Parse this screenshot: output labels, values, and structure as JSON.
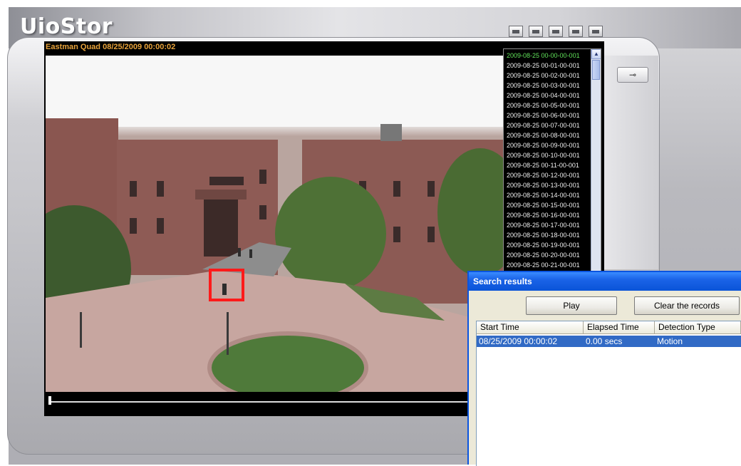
{
  "app": {
    "logo": "UioStor"
  },
  "toolbar": {
    "buttons": [
      {
        "icon": "snapshot-icon"
      },
      {
        "icon": "save-icon"
      },
      {
        "icon": "zip-icon"
      },
      {
        "icon": "print-icon"
      },
      {
        "icon": "fullscreen-icon"
      }
    ]
  },
  "player": {
    "title": "Eastman Quad 08/25/2009 00:00:02",
    "tool_button": "⊸"
  },
  "timelist": {
    "items": [
      "2009-08-25 00-00-00-001",
      "2009-08-25 00-01-00-001",
      "2009-08-25 00-02-00-001",
      "2009-08-25 00-03-00-001",
      "2009-08-25 00-04-00-001",
      "2009-08-25 00-05-00-001",
      "2009-08-25 00-06-00-001",
      "2009-08-25 00-07-00-001",
      "2009-08-25 00-08-00-001",
      "2009-08-25 00-09-00-001",
      "2009-08-25 00-10-00-001",
      "2009-08-25 00-11-00-001",
      "2009-08-25 00-12-00-001",
      "2009-08-25 00-13-00-001",
      "2009-08-25 00-14-00-001",
      "2009-08-25 00-15-00-001",
      "2009-08-25 00-16-00-001",
      "2009-08-25 00-17-00-001",
      "2009-08-25 00-18-00-001",
      "2009-08-25 00-19-00-001",
      "2009-08-25 00-20-00-001",
      "2009-08-25 00-21-00-001"
    ],
    "selected_index": 0,
    "scroll_up": "▲"
  },
  "search_results": {
    "title": "Search results",
    "play_label": "Play",
    "clear_label": "Clear the records",
    "columns": [
      "Start Time",
      "Elapsed Time",
      "Detection Type"
    ],
    "rows": [
      [
        "08/25/2009 00:00:02",
        "0.00 secs",
        "Motion"
      ]
    ]
  }
}
